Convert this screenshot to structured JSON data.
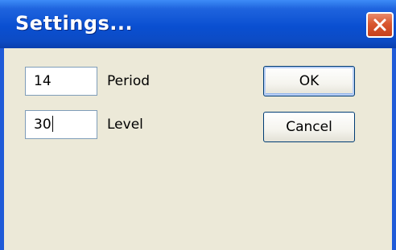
{
  "window": {
    "title": "Settings..."
  },
  "fields": {
    "period": {
      "value": "14",
      "label": "Period"
    },
    "level": {
      "value": "30",
      "label": "Level"
    }
  },
  "buttons": {
    "ok_label": "OK",
    "cancel_label": "Cancel"
  },
  "icons": {
    "close": "close-icon"
  },
  "colors": {
    "titlebar": "#0a4fd1",
    "close_button": "#d9572f",
    "dialog_background": "#ece9d8",
    "field_border": "#7f9db9"
  }
}
